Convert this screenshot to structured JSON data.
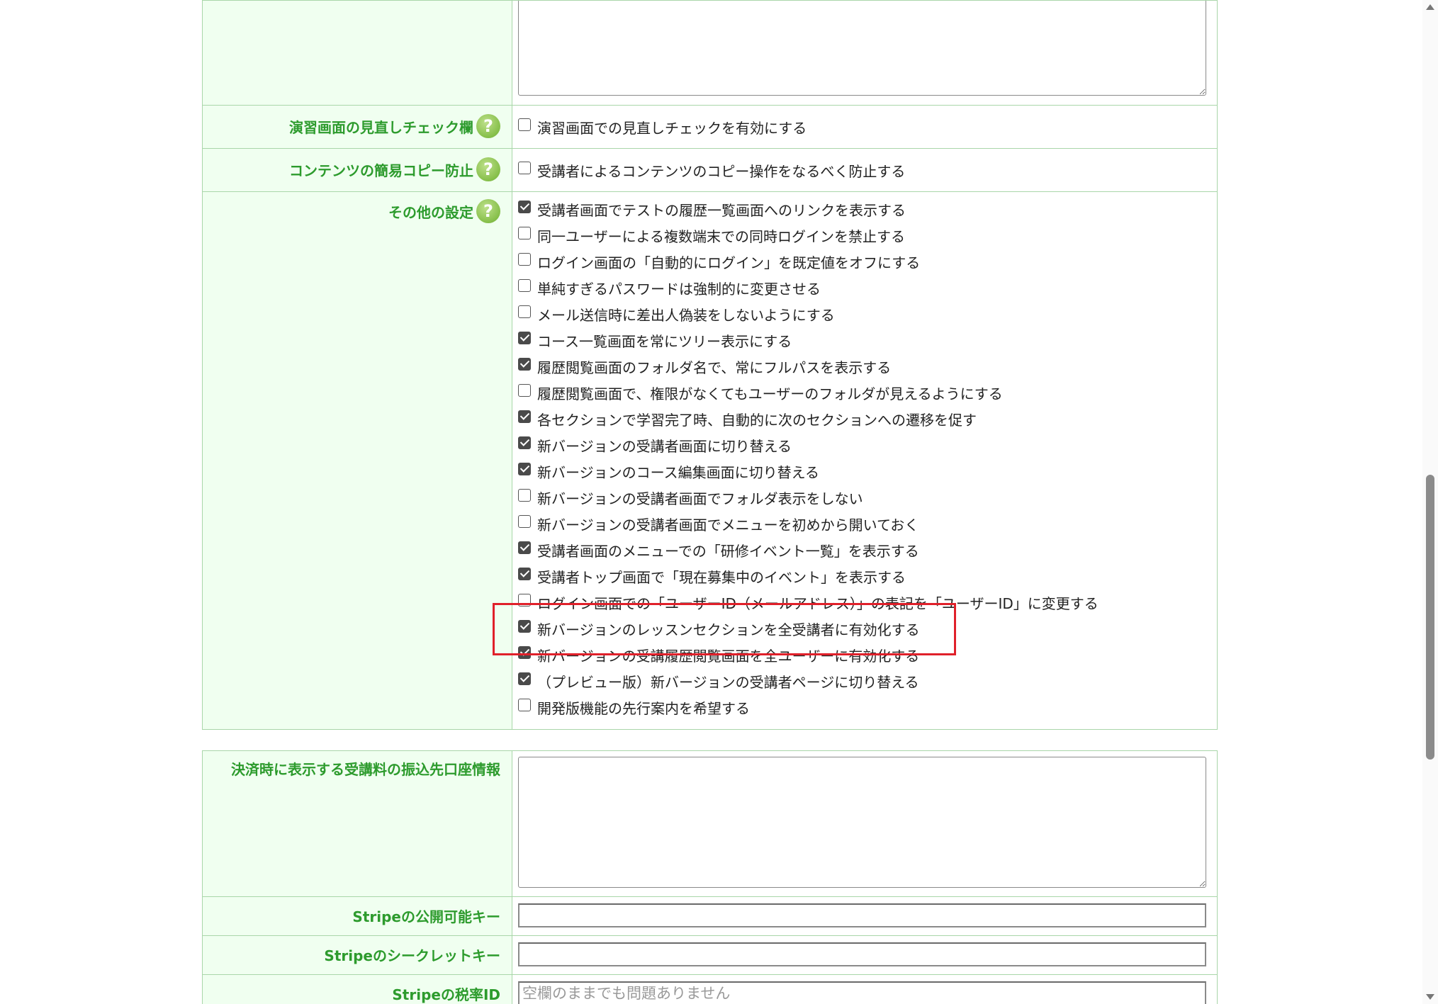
{
  "top_section": {
    "rows": [
      {
        "label": "演習画面の見直しチェック欄",
        "options": [
          {
            "text": "演習画面での見直しチェックを有効にする",
            "checked": false
          }
        ]
      },
      {
        "label": "コンテンツの簡易コピー防止",
        "options": [
          {
            "text": "受講者によるコンテンツのコピー操作をなるべく防止する",
            "checked": false
          }
        ]
      },
      {
        "label": "その他の設定",
        "options": [
          {
            "text": "受講者画面でテストの履歴一覧画面へのリンクを表示する",
            "checked": true
          },
          {
            "text": "同一ユーザーによる複数端末での同時ログインを禁止する",
            "checked": false
          },
          {
            "text": "ログイン画面の「自動的にログイン」を既定値をオフにする",
            "checked": false
          },
          {
            "text": "単純すぎるパスワードは強制的に変更させる",
            "checked": false
          },
          {
            "text": "メール送信時に差出人偽装をしないようにする",
            "checked": false
          },
          {
            "text": "コース一覧画面を常にツリー表示にする",
            "checked": true
          },
          {
            "text": "履歴閲覧画面のフォルダ名で、常にフルパスを表示する",
            "checked": true
          },
          {
            "text": "履歴閲覧画面で、権限がなくてもユーザーのフォルダが見えるようにする",
            "checked": false
          },
          {
            "text": "各セクションで学習完了時、自動的に次のセクションへの遷移を促す",
            "checked": true
          },
          {
            "text": "新バージョンの受講者画面に切り替える",
            "checked": true
          },
          {
            "text": "新バージョンのコース編集画面に切り替える",
            "checked": true
          },
          {
            "text": "新バージョンの受講者画面でフォルダ表示をしない",
            "checked": false
          },
          {
            "text": "新バージョンの受講者画面でメニューを初めから開いておく",
            "checked": false
          },
          {
            "text": "受講者画面のメニューでの「研修イベント一覧」を表示する",
            "checked": true
          },
          {
            "text": "受講者トップ画面で「現在募集中のイベント」を表示する",
            "checked": true
          },
          {
            "text": "ログイン画面での「ユーザーID（メールアドレス）」の表記を「ユーザーID」に変更する",
            "checked": false
          },
          {
            "text": "新バージョンのレッスンセクションを全受講者に有効化する",
            "checked": true
          },
          {
            "text": "新バージョンの受講履歴閲覧画面を全ユーザーに有効化する",
            "checked": true
          },
          {
            "text": "（プレビュー版）新バージョンの受講者ページに切り替える",
            "checked": true
          },
          {
            "text": "開発版機能の先行案内を希望する",
            "checked": false
          }
        ]
      }
    ]
  },
  "payment_section": {
    "bank_info_label": "決済時に表示する受講料の振込先口座情報",
    "stripe_public_key_label": "Stripeの公開可能キー",
    "stripe_secret_key_label": "Stripeのシークレットキー",
    "stripe_tax_rate_label": "Stripeの税率ID",
    "stripe_tax_rate_placeholder": "空欄のままでも問題ありません"
  },
  "help_icon_glyph": "?",
  "icons": {
    "help": "question-circle-icon"
  },
  "colors": {
    "label_text": "#2d9b2d",
    "label_bg": "#f0fff0",
    "border": "#a9d6a9",
    "highlight": "#e0202a"
  }
}
